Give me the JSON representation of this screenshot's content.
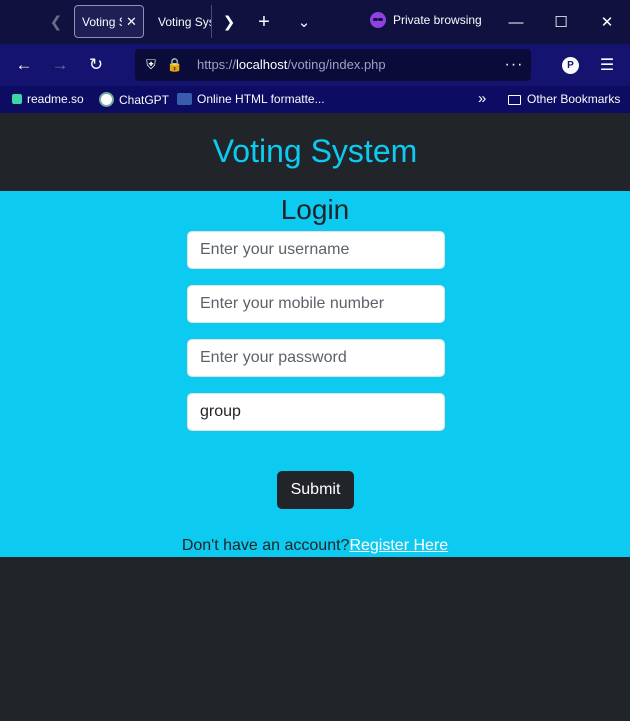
{
  "browser": {
    "tabs": [
      {
        "title": "Voting System",
        "active": true
      },
      {
        "title": "Voting System",
        "active": false
      }
    ],
    "private_label": "Private browsing",
    "url_prefix": "https://",
    "url_host": "localhost",
    "url_path": "/voting/index.php",
    "bookmarks": [
      "readme.so",
      "ChatGPT",
      "Online HTML formatte..."
    ],
    "other_bookmarks": "Other Bookmarks",
    "profile_initial": "P"
  },
  "page": {
    "site_title": "Voting System",
    "login_title": "Login",
    "username_placeholder": "Enter your username",
    "mobile_placeholder": "Enter your mobile number",
    "password_placeholder": "Enter your password",
    "group_value": "group",
    "submit_label": "Submit",
    "register_text": "Don't have an account?",
    "register_link": "Register Here"
  },
  "colors": {
    "accent": "#0dcaf0",
    "dark": "#212529"
  }
}
